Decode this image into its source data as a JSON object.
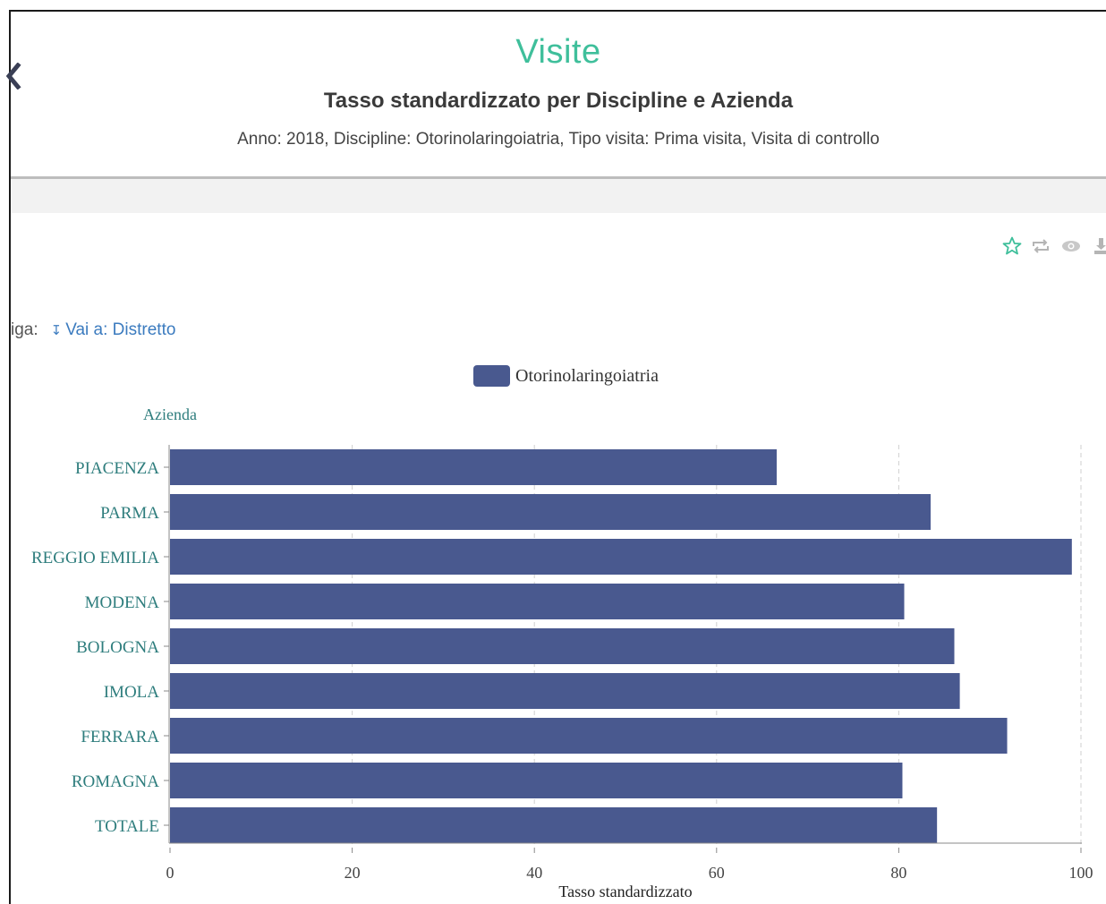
{
  "header": {
    "title": "Visite",
    "subtitle": "Tasso standardizzato per Discipline e Azienda",
    "filters": "Anno: 2018, Discipline: Otorinolaringoiatria, Tipo visita: Prima visita, Visita di controllo"
  },
  "nav": {
    "back_icon": "chevron-left-icon"
  },
  "actions": [
    {
      "icon": "star-icon",
      "color": "#3fbf9b"
    },
    {
      "icon": "repeat-icon",
      "color": "#b5b5b5"
    },
    {
      "icon": "eye-icon",
      "color": "#b5b5b5"
    },
    {
      "icon": "download-icon",
      "color": "#b5b5b5"
    }
  ],
  "drilldown": {
    "label": "iga:",
    "link": "Vai a: Distretto"
  },
  "colors": {
    "accent": "#3fbf9b",
    "bar": "#49598f",
    "tick_label": "#2e7d7d",
    "link": "#3b7bbf"
  },
  "chart_data": {
    "type": "bar",
    "orientation": "horizontal",
    "legend": [
      "Otorinolaringoiatria"
    ],
    "legend_position": "top-center",
    "ylabel": "Azienda",
    "xlabel": "Tasso standardizzato",
    "categories": [
      "PIACENZA",
      "PARMA",
      "REGGIO EMILIA",
      "MODENA",
      "BOLOGNA",
      "IMOLA",
      "FERRARA",
      "ROMAGNA",
      "TOTALE"
    ],
    "series": [
      {
        "name": "Otorinolaringoiatria",
        "values": [
          66.6,
          83.5,
          99.0,
          80.6,
          86.1,
          86.7,
          91.9,
          80.4,
          84.2
        ]
      }
    ],
    "xlim": [
      0,
      100
    ],
    "xticks": [
      0,
      20,
      40,
      60,
      80,
      100
    ],
    "grid": "vertical dashed"
  }
}
